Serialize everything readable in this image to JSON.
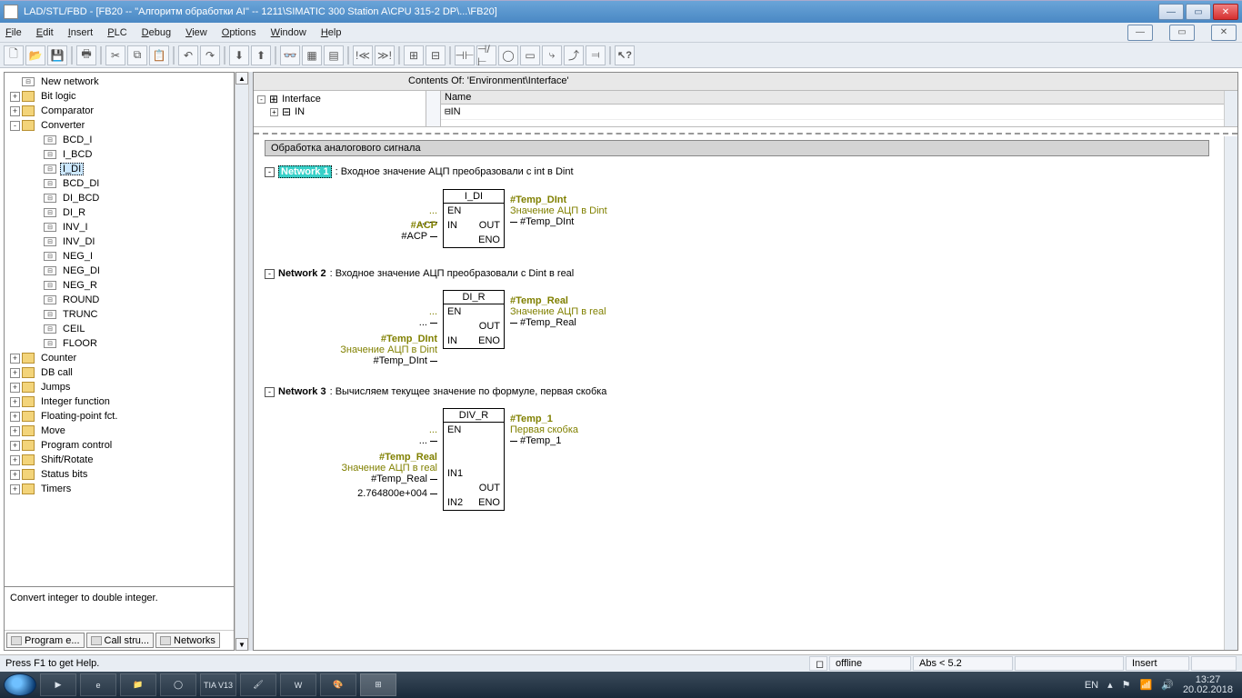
{
  "title": "LAD/STL/FBD  - [FB20 -- \"Алгоритм обработки AI\" -- 1211\\SIMATIC 300 Station A\\CPU 315-2 DP\\...\\FB20]",
  "menu": [
    "File",
    "Edit",
    "Insert",
    "PLC",
    "Debug",
    "View",
    "Options",
    "Window",
    "Help"
  ],
  "left_tree": {
    "top": [
      {
        "label": "New network",
        "exp": "",
        "icon": "blk",
        "indent": 4
      },
      {
        "label": "Bit logic",
        "exp": "+",
        "icon": "folder",
        "indent": 4
      },
      {
        "label": "Comparator",
        "exp": "+",
        "icon": "folder",
        "indent": 4
      },
      {
        "label": "Converter",
        "exp": "-",
        "icon": "folder",
        "indent": 4
      }
    ],
    "converter_items": [
      "BCD_I",
      "I_BCD",
      "I_DI",
      "BCD_DI",
      "DI_BCD",
      "DI_R",
      "INV_I",
      "INV_DI",
      "NEG_I",
      "NEG_DI",
      "NEG_R",
      "ROUND",
      "TRUNC",
      "CEIL",
      "FLOOR"
    ],
    "converter_selected": "I_DI",
    "bottom": [
      {
        "label": "Counter",
        "exp": "+",
        "icon": "folder"
      },
      {
        "label": "DB call",
        "exp": "+",
        "icon": "folder"
      },
      {
        "label": "Jumps",
        "exp": "+",
        "icon": "folder"
      },
      {
        "label": "Integer function",
        "exp": "+",
        "icon": "folder"
      },
      {
        "label": "Floating-point fct.",
        "exp": "+",
        "icon": "folder"
      },
      {
        "label": "Move",
        "exp": "+",
        "icon": "folder"
      },
      {
        "label": "Program control",
        "exp": "+",
        "icon": "folder"
      },
      {
        "label": "Shift/Rotate",
        "exp": "+",
        "icon": "folder"
      },
      {
        "label": "Status bits",
        "exp": "+",
        "icon": "folder"
      },
      {
        "label": "Timers",
        "exp": "+",
        "icon": "folder"
      }
    ],
    "hint": "Convert integer to double integer.",
    "tabs": [
      "Program e...",
      "Call stru...",
      "Networks"
    ]
  },
  "contents_of": "Contents Of: 'Environment\\Interface'",
  "iface_tree": {
    "root": "Interface",
    "child": "IN"
  },
  "name_header": "Name",
  "name_value": "IN",
  "editor_title": "Обработка аналогового сигнала",
  "networks": [
    {
      "num": "Network 1",
      "hl": true,
      "desc": "Входное значение АЦП преобразовали с int в Dint",
      "block": "I_DI",
      "left": [
        {
          "tag": "",
          "comment": "...",
          "sig": "",
          "port": ""
        },
        {
          "tag": "#ACP",
          "comment": "",
          "sig": "#ACP",
          "port": "IN"
        }
      ],
      "ports_l": [
        "EN",
        "IN"
      ],
      "ports_r": [
        "",
        "OUT",
        "ENO"
      ],
      "right": [
        {
          "tag": "#Temp_DInt",
          "comment": "Значение АЦП в Dint",
          "sig": "#Temp_DInt",
          "port": "OUT"
        }
      ]
    },
    {
      "num": "Network 2",
      "hl": false,
      "desc": "Входное значение АЦП преобразовали с Dint в real",
      "block": "DI_R",
      "left": [
        {
          "tag": "",
          "comment": "...",
          "sig": "",
          "port": ""
        },
        {
          "tag": "#Temp_DInt",
          "comment": "Значение АЦП в Dint",
          "sig": "#Temp_DInt",
          "port": "IN"
        }
      ],
      "ports_l": [
        "EN",
        "",
        "IN"
      ],
      "ports_r": [
        "",
        "OUT",
        "ENO"
      ],
      "right": [
        {
          "tag": "#Temp_Real",
          "comment": "Значение АЦП в real",
          "sig": "#Temp_Real",
          "port": "OUT"
        }
      ]
    },
    {
      "num": "Network 3",
      "hl": false,
      "desc": "Вычисляем текущее значение по формуле, первая скобка",
      "block": "DIV_R",
      "left": [
        {
          "tag": "",
          "comment": "...",
          "sig": "",
          "port": ""
        },
        {
          "tag": "#Temp_Real",
          "comment": "Значение АЦП в real",
          "sig": "#Temp_Real",
          "port": "IN1"
        },
        {
          "tag": "",
          "comment": "",
          "sig": "2.764800e+004",
          "port": "IN2"
        }
      ],
      "ports_l": [
        "EN",
        "",
        "",
        "IN1",
        "",
        "IN2"
      ],
      "ports_r": [
        "",
        "",
        "",
        "",
        "OUT",
        "ENO"
      ],
      "right": [
        {
          "tag": "#Temp_1",
          "comment": "Первая скобка",
          "sig": "#Temp_1",
          "port": "OUT"
        }
      ]
    }
  ],
  "status": {
    "help": "Press F1 to get Help.",
    "offline": "offline",
    "abs": "Abs < 5.2",
    "insert": "Insert"
  },
  "taskbar": {
    "lang": "EN",
    "time": "13:27",
    "date": "20.02.2018",
    "apps": [
      "▶",
      "e",
      "📁",
      "◯",
      "TIA V13",
      "🖌",
      "W",
      "🎨",
      "⊞"
    ]
  }
}
